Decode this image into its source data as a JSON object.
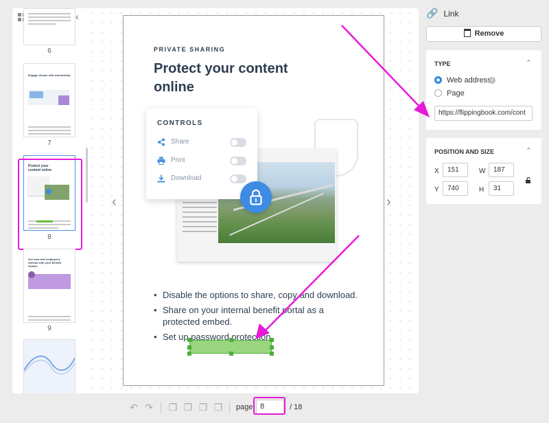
{
  "thumbnails": [
    {
      "number": "6",
      "title": "",
      "selected": false
    },
    {
      "number": "7",
      "title": "Engage deeper with interactivity",
      "selected": false
    },
    {
      "number": "8",
      "title": "Protect your content online",
      "selected": true
    },
    {
      "number": "9",
      "title": "See how well employees interact with your Benefit Guides",
      "selected": false
    },
    {
      "number": "",
      "title": "",
      "selected": false
    }
  ],
  "page_content": {
    "eyebrow": "PRIVATE SHARING",
    "headline": "Protect your content online",
    "controls_title": "CONTROLS",
    "controls": [
      {
        "label": "Share",
        "icon": "share-icon"
      },
      {
        "label": "Print",
        "icon": "print-icon"
      },
      {
        "label": "Download",
        "icon": "download-icon"
      }
    ],
    "bullets": [
      "Disable the options to share, copy and download.",
      "Share on your internal benefit portal as a protected embed.",
      "Set up password protection"
    ]
  },
  "right_panel": {
    "title": "Link",
    "remove_label": "Remove",
    "type_header": "TYPE",
    "web_address_label": "Web address",
    "page_option_label": "Page",
    "url_value": "https://flippingbook.com/cont",
    "position_header": "POSITION AND SIZE",
    "x_label": "X",
    "x_value": "151",
    "w_label": "W",
    "w_value": "187",
    "y_label": "Y",
    "y_value": "740",
    "h_label": "H",
    "h_value": "31"
  },
  "bottom_bar": {
    "page_label": "page",
    "page_value": "8",
    "page_total": "/ 18"
  },
  "colors": {
    "accent_blue": "#2f86d8",
    "link_green": "#4caf3a",
    "highlight_magenta": "#e619d9",
    "headline_navy": "#2c3e50"
  }
}
